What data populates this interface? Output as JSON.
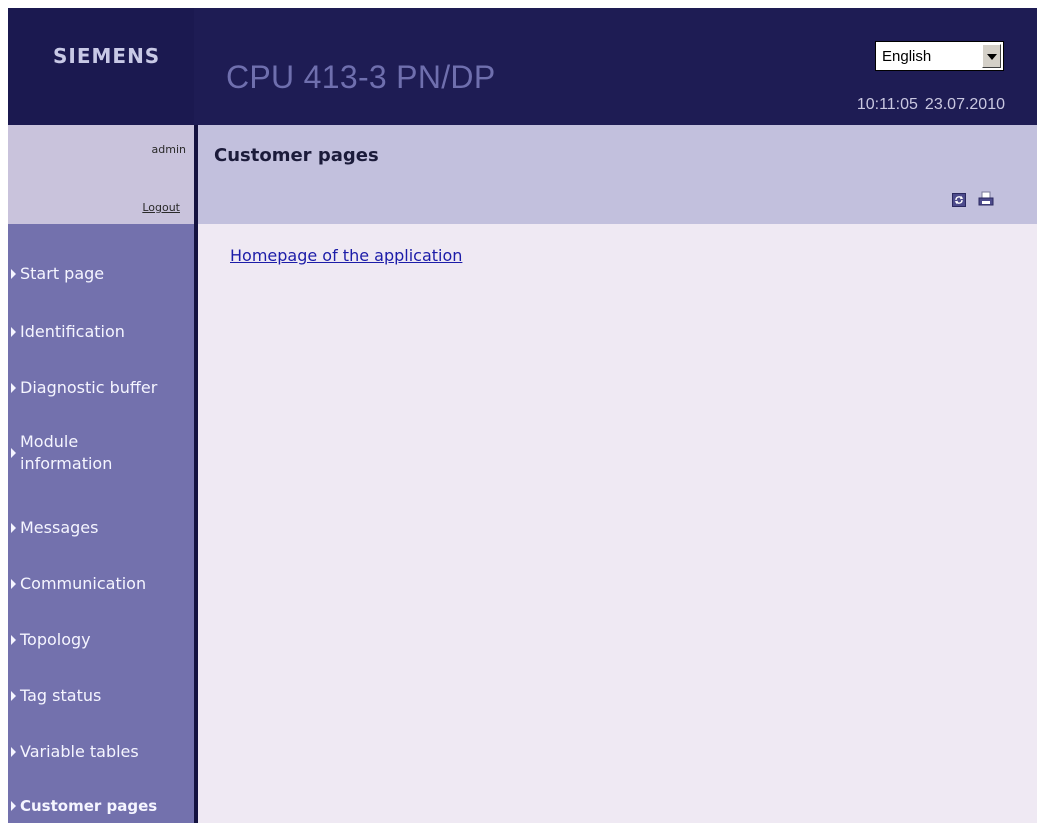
{
  "brand": {
    "logo": "SIEMENS"
  },
  "header": {
    "title": "CPU 413-3 PN/DP",
    "language": {
      "selected": "English"
    },
    "time": "10:11:05",
    "date": "23.07.2010"
  },
  "user": {
    "name": "admin",
    "logout_label": "Logout"
  },
  "content": {
    "title": "Customer pages",
    "toolbar": {
      "refresh_icon": "refresh-icon",
      "print_icon": "print-icon"
    },
    "link": "Homepage of the application"
  },
  "sidebar": {
    "items": [
      {
        "label": "Start page"
      },
      {
        "label": "Identification"
      },
      {
        "label": "Diagnostic buffer"
      },
      {
        "label": "Module information"
      },
      {
        "label": "Messages"
      },
      {
        "label": "Communication"
      },
      {
        "label": "Topology"
      },
      {
        "label": "Tag status"
      },
      {
        "label": "Variable tables"
      },
      {
        "label": "Customer pages",
        "active": true
      }
    ]
  },
  "colors": {
    "header": "#1e1c54",
    "sidebar": "#7371ad",
    "content_header": "#c2c0dd",
    "page_background": "#efe9f3",
    "link": "#1c1ca8"
  }
}
